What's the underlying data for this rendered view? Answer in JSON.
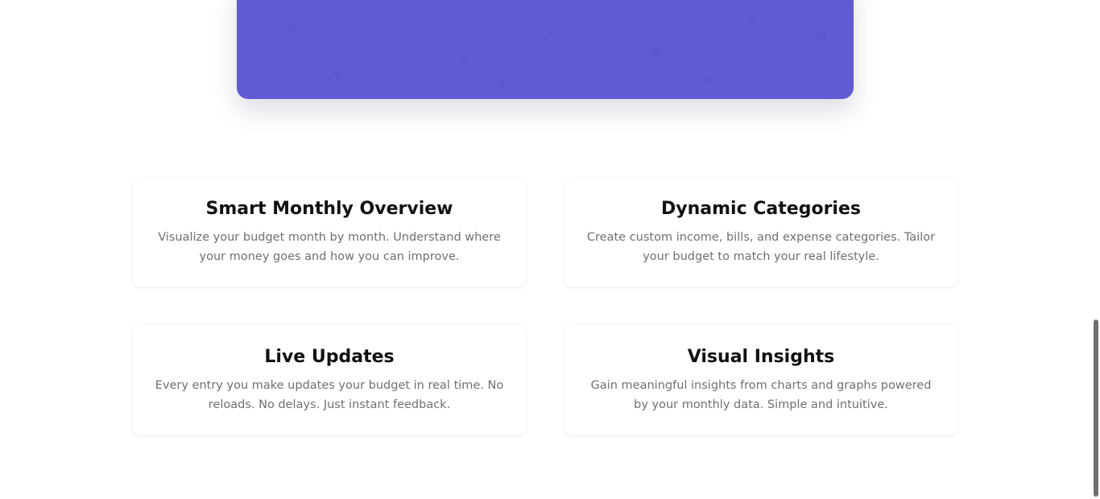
{
  "hero": {
    "color": "#605bd4"
  },
  "features": [
    {
      "title": "Smart Monthly Overview",
      "description": "Visualize your budget month by month. Understand where your money goes and how you can improve."
    },
    {
      "title": "Dynamic Categories",
      "description": "Create custom income, bills, and expense categories. Tailor your budget to match your real lifestyle."
    },
    {
      "title": "Live Updates",
      "description": "Every entry you make updates your budget in real time. No reloads. No delays. Just instant feedback."
    },
    {
      "title": "Visual Insights",
      "description": "Gain meaningful insights from charts and graphs powered by your monthly data. Simple and intuitive."
    }
  ]
}
